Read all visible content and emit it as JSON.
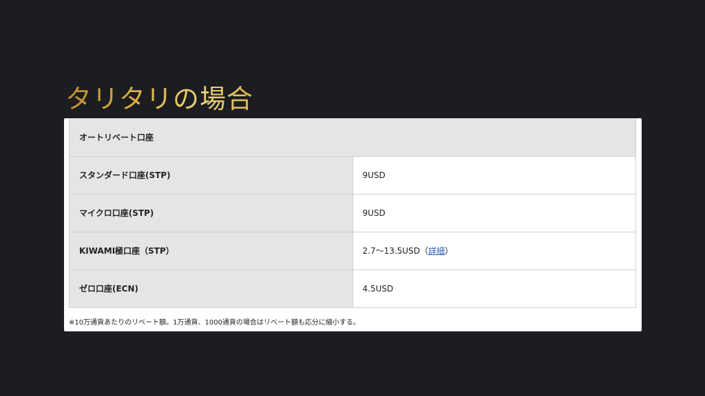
{
  "slide": {
    "title": "タリタリの場合"
  },
  "table": {
    "header": "オートリベート口座",
    "rows": [
      {
        "label": "スタンダード口座(STP)",
        "value": "9USD"
      },
      {
        "label": "マイクロ口座(STP)",
        "value": "9USD"
      },
      {
        "label": "KIWAMI極口座（STP）",
        "value": "2.7〜13.5USD",
        "open_paren": "（",
        "link_text": "詳細",
        "close_paren": "）"
      },
      {
        "label": "ゼロ口座(ECN)",
        "value": "4.5USD"
      }
    ],
    "footnote": "※10万通貨あたりのリベート額。1万通貨、1000通貨の場合はリベート額も応分に縮小する。"
  },
  "colors": {
    "background": "#1c1d20",
    "title_gold": "#d8b04c",
    "label_cell_bg": "#e5e5e5",
    "link": "#2a5db0"
  }
}
